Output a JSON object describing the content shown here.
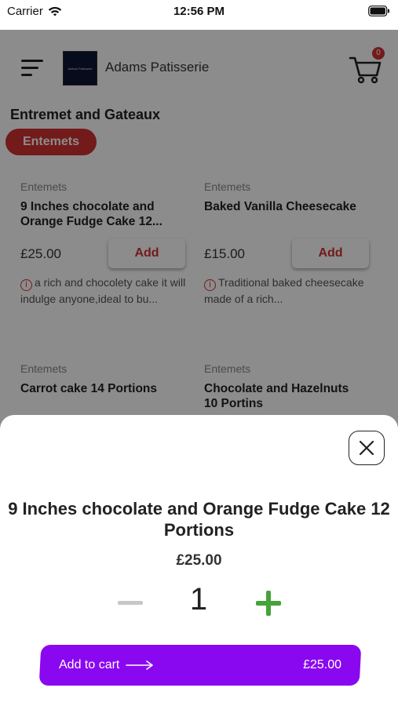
{
  "status_bar": {
    "carrier": "Carrier",
    "time": "12:56 PM"
  },
  "header": {
    "store_name": "Adams Patisserie",
    "cart_count": "0",
    "logo_text": "Adams Patisserie"
  },
  "section": {
    "title": "Entremet and Gateaux",
    "chip": "Entemets"
  },
  "products": [
    {
      "category": "Entemets",
      "name": "9 Inches chocolate and Orange Fudge Cake 12...",
      "price": "£25.00",
      "add_label": "Add",
      "description": "a rich and chocolety cake it will indulge anyone,ideal to bu..."
    },
    {
      "category": "Entemets",
      "name": "Baked Vanilla Cheesecake",
      "price": "£15.00",
      "add_label": "Add",
      "description": "Traditional baked cheesecake made of a rich..."
    },
    {
      "category": "Entemets",
      "name": "Carrot cake 14 Portions"
    },
    {
      "category": "Entemets",
      "name": "Chocolate and Hazelnuts 10 Portins"
    }
  ],
  "sheet": {
    "title": "9 Inches chocolate and Orange Fudge Cake 12 Portions",
    "price": "£25.00",
    "quantity": "1",
    "add_to_cart_label": "Add to cart",
    "total": "£25.00"
  },
  "colors": {
    "accent_red": "#d23131",
    "purple": "#8a08f0",
    "green": "#46a23a"
  }
}
